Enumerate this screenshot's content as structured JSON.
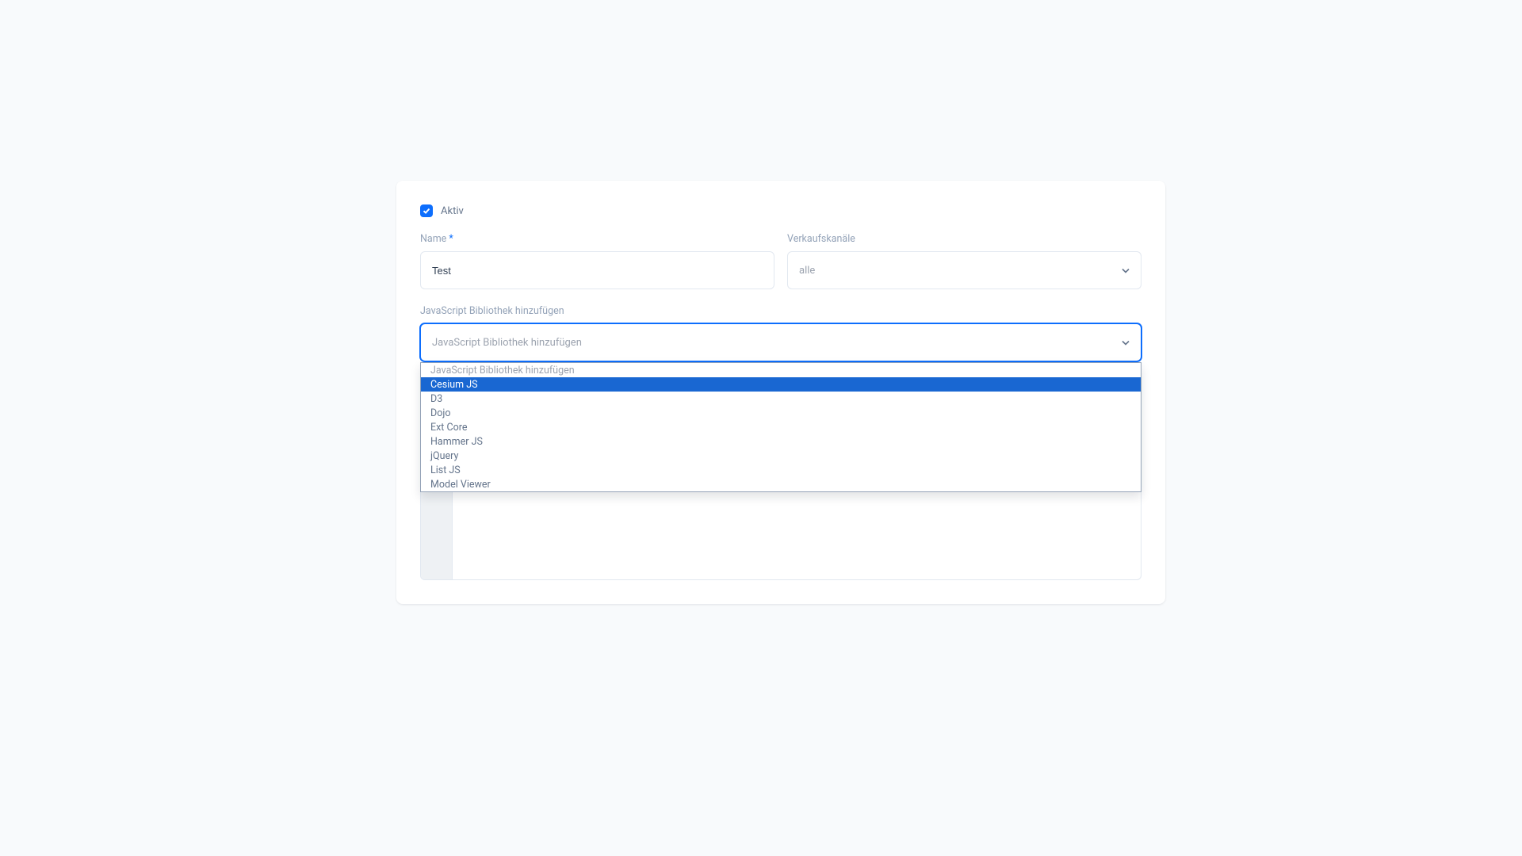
{
  "checkbox": {
    "label": "Aktiv",
    "checked": true
  },
  "name": {
    "label": "Name",
    "required_mark": "*",
    "value": "Test"
  },
  "channels": {
    "label": "Verkaufskanäle",
    "placeholder": "alle"
  },
  "jslib": {
    "label": "JavaScript Bibliothek hinzufügen",
    "placeholder": "JavaScript Bibliothek hinzufügen"
  },
  "dropdown": {
    "header": "JavaScript Bibliothek hinzufügen",
    "highlighted": "Cesium JS",
    "options": [
      "Cesium JS",
      "D3",
      "Dojo",
      "Ext Core",
      "Hammer JS",
      "jQuery",
      "List JS",
      "Model Viewer"
    ]
  }
}
